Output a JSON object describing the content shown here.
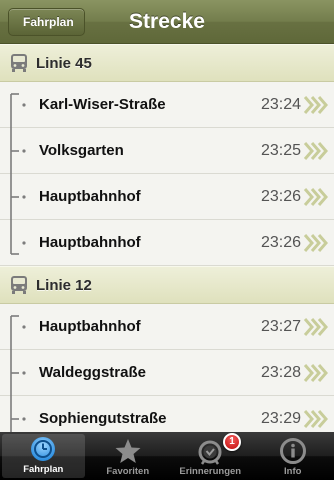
{
  "navbar": {
    "back_label": "Fahrplan",
    "title": "Strecke"
  },
  "sections": [
    {
      "line_label": "Linie 45",
      "stops": [
        {
          "name": "Karl-Wiser-Straße",
          "time": "23:24"
        },
        {
          "name": "Volksgarten",
          "time": "23:25"
        },
        {
          "name": "Hauptbahnhof",
          "time": "23:26"
        },
        {
          "name": "Hauptbahnhof",
          "time": "23:26"
        }
      ]
    },
    {
      "line_label": "Linie 12",
      "stops": [
        {
          "name": "Hauptbahnhof",
          "time": "23:27"
        },
        {
          "name": "Waldeggstraße",
          "time": "23:28"
        },
        {
          "name": "Sophiengutstraße",
          "time": "23:29"
        }
      ]
    }
  ],
  "tabbar": {
    "tabs": [
      {
        "label": "Fahrplan",
        "icon": "clock-icon",
        "active": true
      },
      {
        "label": "Favoriten",
        "icon": "star-icon",
        "active": false
      },
      {
        "label": "Erinnerungen",
        "icon": "alarm-clock-icon",
        "active": false,
        "badge": "1"
      },
      {
        "label": "Info",
        "icon": "info-icon",
        "active": false
      }
    ]
  },
  "colors": {
    "navbar": "#737d4c",
    "section_header": "#e4e6c6",
    "chevron": "#c8cd9a",
    "tab_active_icon": "#4aa8f0",
    "badge": "#d91c1c"
  }
}
